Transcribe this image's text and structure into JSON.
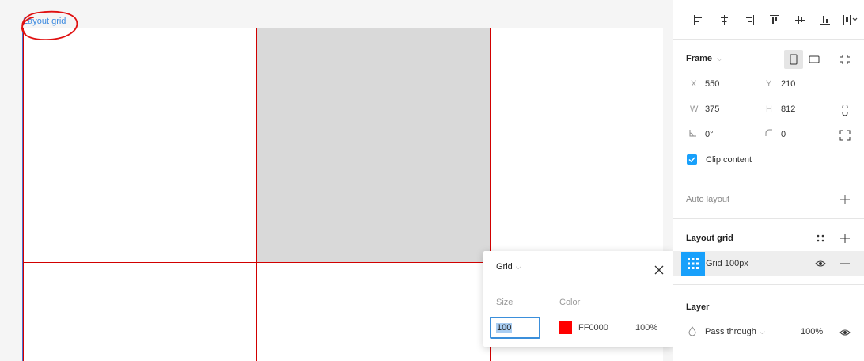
{
  "canvas": {
    "frame_label": "Layout grid"
  },
  "colors": {
    "grid_line": "#d10000",
    "selection": "#4a6fd0",
    "accent": "#18a0fb",
    "annotation": "#e01010",
    "swatch": "#ff0000"
  },
  "align_toolbar": {
    "icons": [
      "align-left-icon",
      "align-horizontal-center-icon",
      "align-right-icon",
      "align-top-icon",
      "align-vertical-center-icon",
      "align-bottom-icon",
      "distribute-icon"
    ]
  },
  "frame": {
    "title": "Frame",
    "x_label": "X",
    "x_value": "550",
    "y_label": "Y",
    "y_value": "210",
    "w_label": "W",
    "w_value": "375",
    "h_label": "H",
    "h_value": "812",
    "rotation_value": "0°",
    "radius_value": "0",
    "clip_content_label": "Clip content",
    "clip_content_checked": true
  },
  "auto_layout": {
    "title": "Auto layout"
  },
  "layout_grid": {
    "title": "Layout grid",
    "item_label": "Grid 100px"
  },
  "layer": {
    "title": "Layer",
    "blend_mode": "Pass through",
    "opacity": "100%"
  },
  "grid_popover": {
    "title": "Grid",
    "size_label": "Size",
    "color_label": "Color",
    "size_value": "100",
    "color_hex": "FF0000",
    "opacity": "100%"
  }
}
